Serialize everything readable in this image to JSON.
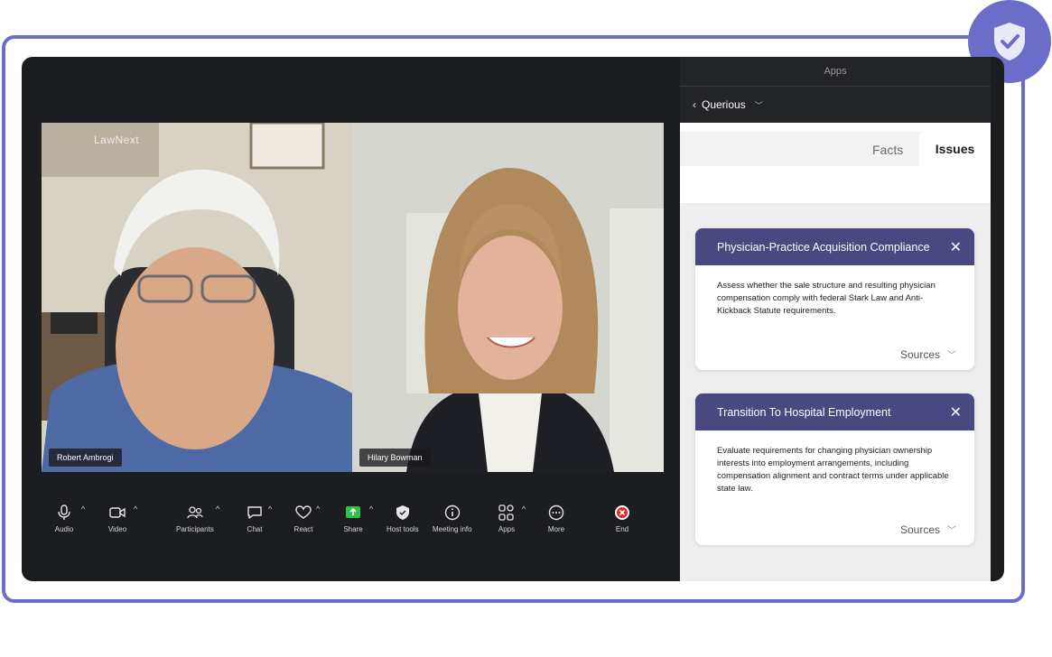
{
  "panel": {
    "header_title": "Apps",
    "app_name": "Querious",
    "tabs": [
      "Facts",
      "Issues"
    ],
    "active_tab": "Issues"
  },
  "video": {
    "watermark": "LawNext",
    "participants": [
      {
        "name": "Robert Ambrogi"
      },
      {
        "name": "Hilary Bowman"
      }
    ]
  },
  "toolbar": {
    "audio": "Audio",
    "video": "Video",
    "participants": "Participants",
    "chat": "Chat",
    "react": "React",
    "share": "Share",
    "host_tools": "Host tools",
    "meeting_info": "Meeting info",
    "apps": "Apps",
    "more": "More",
    "end": "End"
  },
  "issues": [
    {
      "title": "Physician-Practice Acquisition Compliance",
      "description": "Assess whether the sale structure and resulting physician compensation comply with federal Stark Law and Anti-Kickback Statute requirements.",
      "sources_label": "Sources"
    },
    {
      "title": "Transition To Hospital Employment",
      "description": "Evaluate requirements for changing physician ownership interests into employment arrangements, including compensation alignment and contract terms under applicable state law.",
      "sources_label": "Sources"
    }
  ],
  "colors": {
    "frame": "#6c6cc9",
    "card_header": "#4a4880",
    "share_green": "#2fbf4a",
    "end_red": "#e02b2b"
  }
}
